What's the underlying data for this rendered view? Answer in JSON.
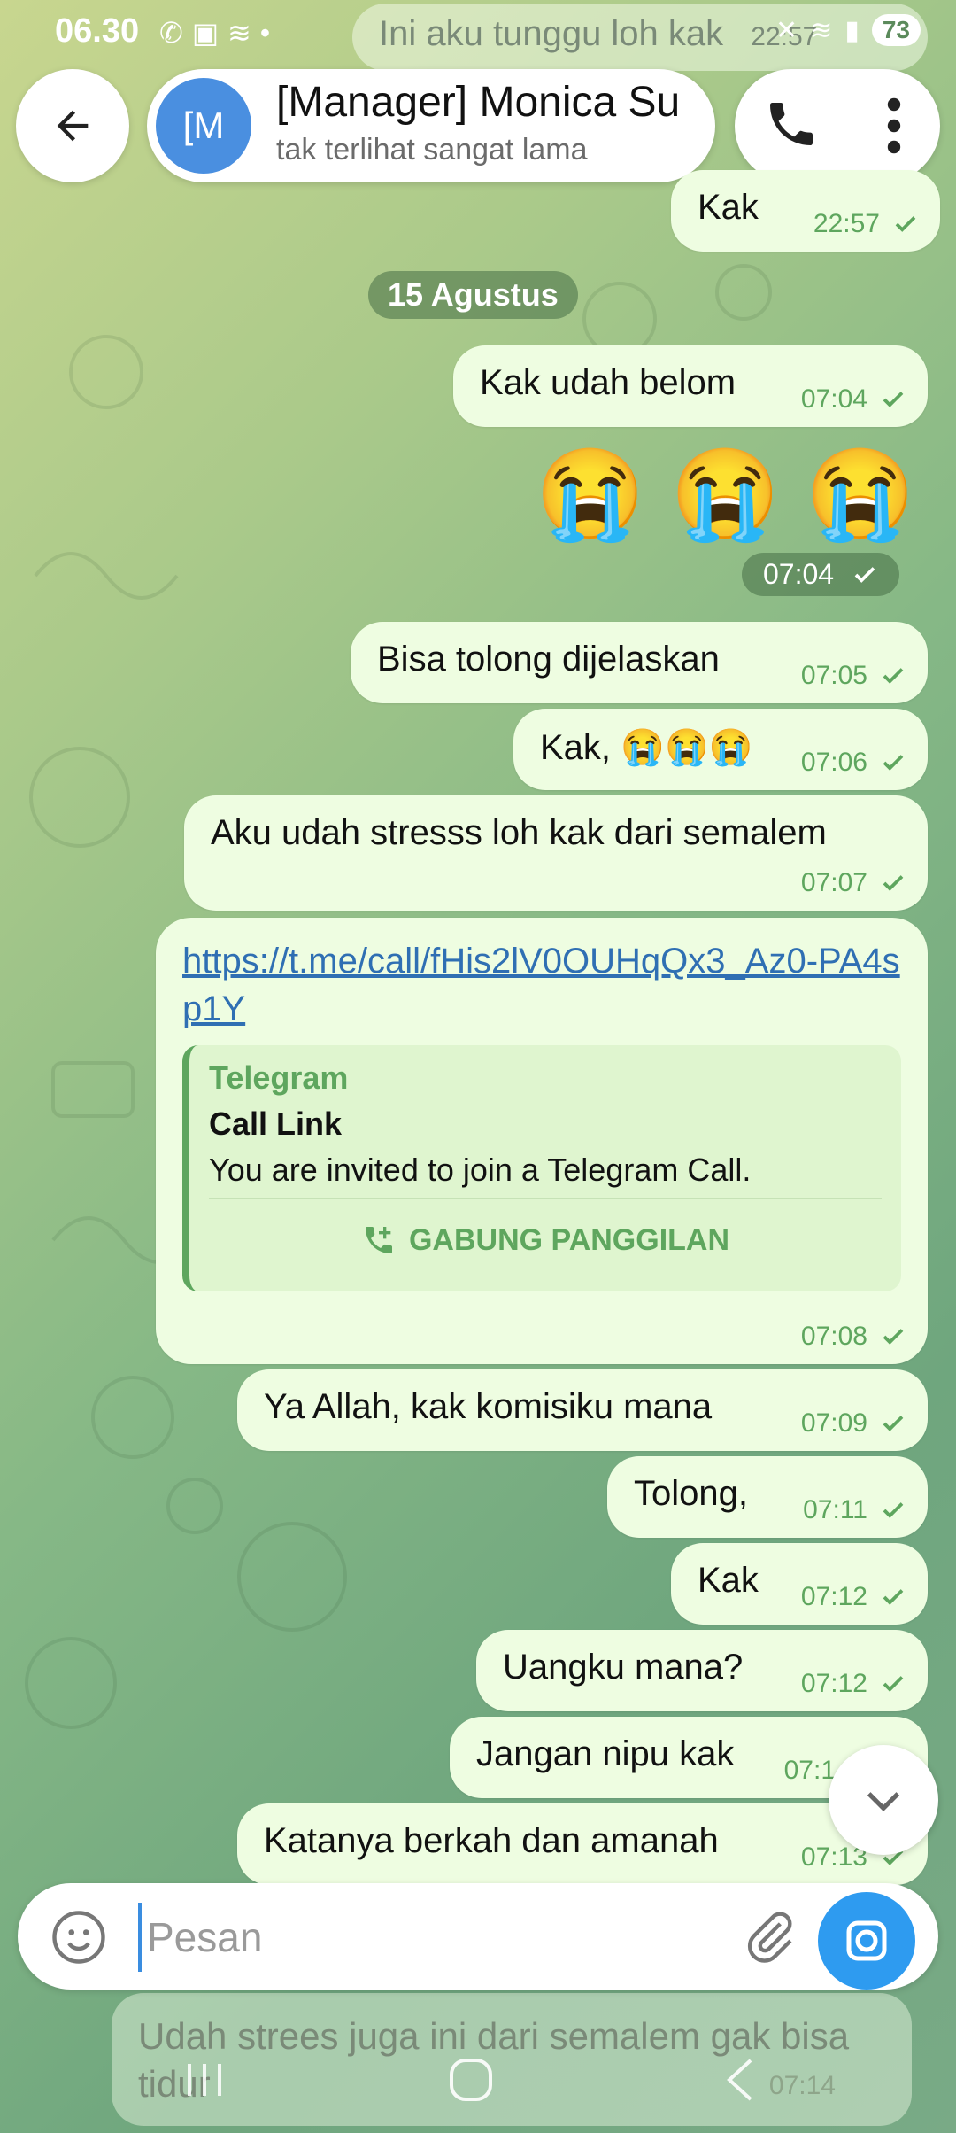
{
  "status_bar": {
    "time": "06.30",
    "notif_icons": [
      "whatsapp-icon",
      "shopee-icon",
      "wifi-icon",
      "dot-icon"
    ],
    "battery": "73"
  },
  "header": {
    "back_label": "←",
    "avatar_text": "[M",
    "title": "[Manager] Monica Su",
    "status": "tak terlihat sangat lama"
  },
  "ghost_top": {
    "text": "Ini aku tunggu loh kak",
    "time": "22:57"
  },
  "date_chip": "15 Agustus",
  "messages": [
    {
      "text": "Kak",
      "time": "22:57"
    },
    {
      "text": "Kak udah belom",
      "time": "07:04"
    },
    {
      "text": "😭 😭 😭",
      "time": "07:04"
    },
    {
      "text": "Bisa tolong dijelaskan",
      "time": "07:05"
    },
    {
      "text": "Kak, 😭😭😭",
      "time": "07:06"
    },
    {
      "text": "Aku udah stresss loh kak dari semalem",
      "time": "07:07"
    },
    {
      "text": "Ya Allah, kak komisiku mana",
      "time": "07:09"
    },
    {
      "text": "Tolong,",
      "time": "07:11"
    },
    {
      "text": "Kak",
      "time": "07:12"
    },
    {
      "text": "Uangku mana?",
      "time": "07:12"
    },
    {
      "text": "Jangan nipu kak",
      "time": "07:1"
    },
    {
      "text": "Katanya berkah dan amanah",
      "time": "07:13"
    }
  ],
  "link_message": {
    "url": "https://t.me/call/fHis2lV0OUHqQx3_Az0-PA4sp1Y",
    "site": "Telegram",
    "title": "Call Link",
    "description": "You are invited to join a Telegram Call.",
    "join_label": "GABUNG PANGGILAN",
    "time": "07:08"
  },
  "input": {
    "placeholder": "Pesan",
    "value": ""
  },
  "ghost_bottom": {
    "text": "Udah strees juga ini dari semalem gak bisa tidur",
    "time": "07:14"
  },
  "colors": {
    "bubble": "#eefde1",
    "accent_green": "#5ea65e",
    "link_blue": "#2f6fb3",
    "camera_blue": "#2e9bf0"
  }
}
